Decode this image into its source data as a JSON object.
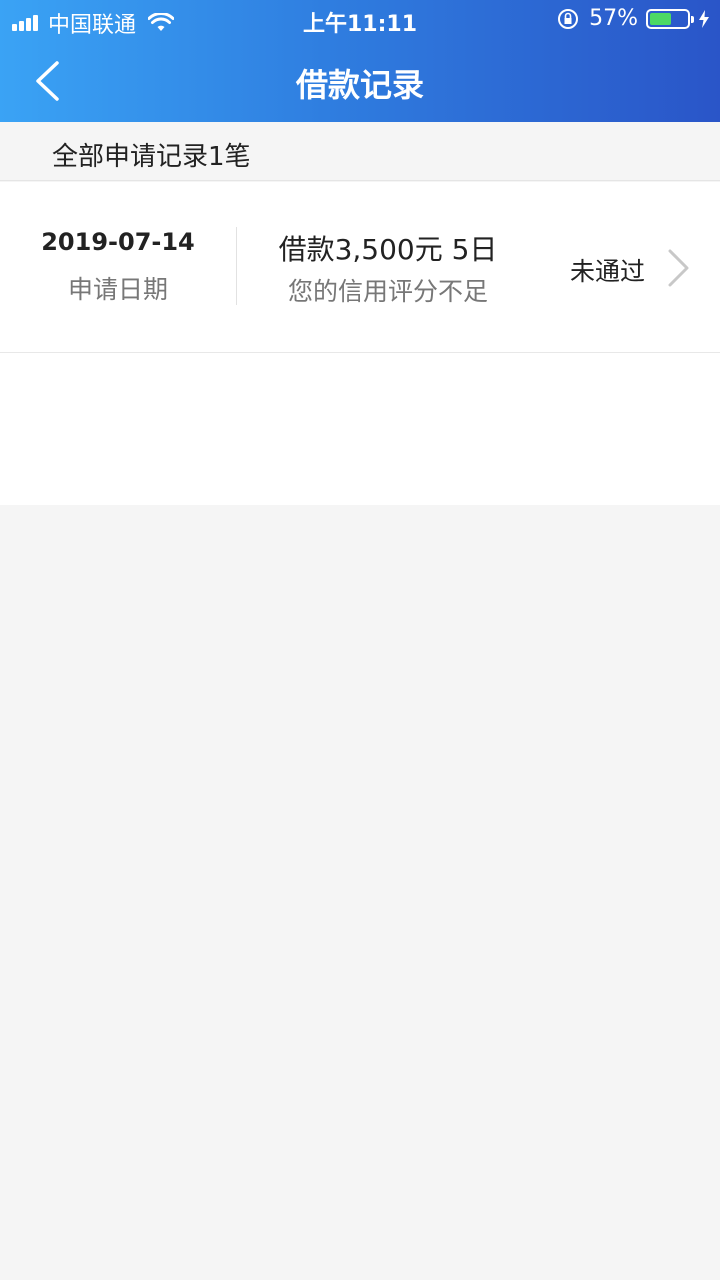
{
  "status_bar": {
    "carrier": "中国联通",
    "time": "上午11:11",
    "battery_percent": "57%",
    "battery_level": 0.57,
    "signal_bars": 4
  },
  "nav": {
    "title": "借款记录"
  },
  "summary": {
    "text": "全部申请记录1笔"
  },
  "records": [
    {
      "date": "2019-07-14",
      "date_label": "申请日期",
      "loan": "借款3,500元 5日",
      "reason": "您的信用评分不足",
      "status": "未通过"
    }
  ],
  "colors": {
    "header_start": "#3aa3f5",
    "header_end": "#2a55c8",
    "battery": "#4cd964"
  }
}
